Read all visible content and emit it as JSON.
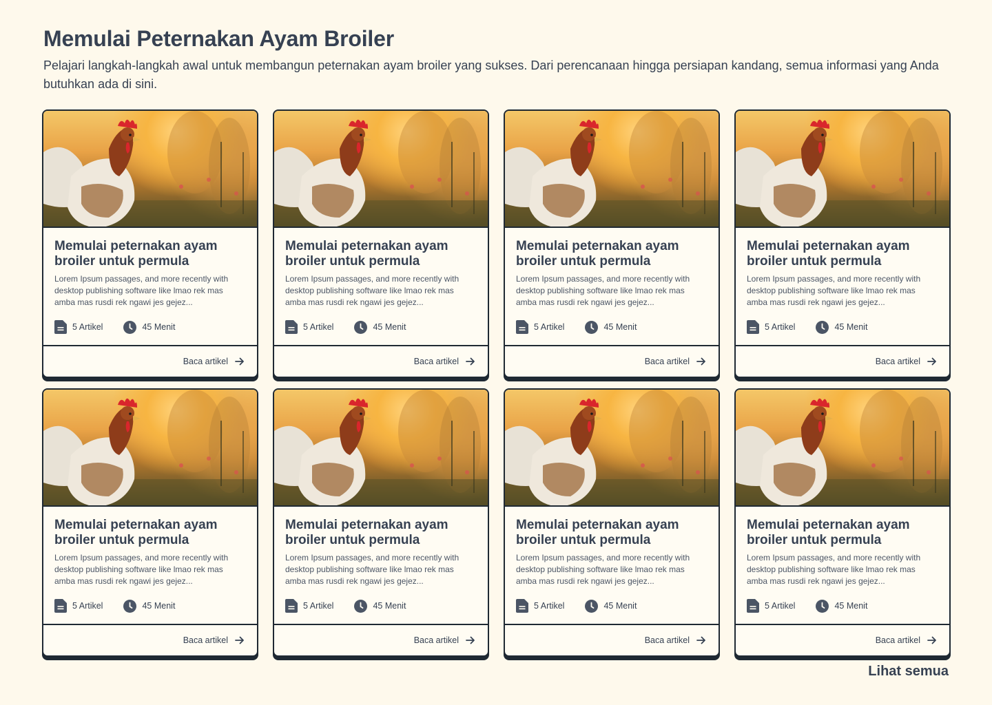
{
  "header": {
    "title": "Memulai Peternakan Ayam Broiler",
    "subtitle": "Pelajari langkah-langkah awal untuk membangun peternakan ayam broiler yang sukses. Dari perencanaan hingga persiapan kandang, semua informasi yang Anda butuhkan ada di sini."
  },
  "cards": [
    {
      "title": "Memulai peternakan ayam broiler untuk permula",
      "desc": "Lorem Ipsum passages, and more recently with desktop publishing software like lmao rek mas amba mas rusdi rek ngawi jes gejez...",
      "articles": "5 Artikel",
      "duration": "45 Menit",
      "cta": "Baca artikel"
    },
    {
      "title": "Memulai peternakan ayam broiler untuk permula",
      "desc": "Lorem Ipsum passages, and more recently with desktop publishing software like lmao rek mas amba mas rusdi rek ngawi jes gejez...",
      "articles": "5 Artikel",
      "duration": "45 Menit",
      "cta": "Baca artikel"
    },
    {
      "title": "Memulai peternakan ayam broiler untuk permula",
      "desc": "Lorem Ipsum passages, and more recently with desktop publishing software like lmao rek mas amba mas rusdi rek ngawi jes gejez...",
      "articles": "5 Artikel",
      "duration": "45 Menit",
      "cta": "Baca artikel"
    },
    {
      "title": "Memulai peternakan ayam broiler untuk permula",
      "desc": "Lorem Ipsum passages, and more recently with desktop publishing software like lmao rek mas amba mas rusdi rek ngawi jes gejez...",
      "articles": "5 Artikel",
      "duration": "45 Menit",
      "cta": "Baca artikel"
    },
    {
      "title": "Memulai peternakan ayam broiler untuk permula",
      "desc": "Lorem Ipsum passages, and more recently with desktop publishing software like lmao rek mas amba mas rusdi rek ngawi jes gejez...",
      "articles": "5 Artikel",
      "duration": "45 Menit",
      "cta": "Baca artikel"
    },
    {
      "title": "Memulai peternakan ayam broiler untuk permula",
      "desc": "Lorem Ipsum passages, and more recently with desktop publishing software like lmao rek mas amba mas rusdi rek ngawi jes gejez...",
      "articles": "5 Artikel",
      "duration": "45 Menit",
      "cta": "Baca artikel"
    },
    {
      "title": "Memulai peternakan ayam broiler untuk permula",
      "desc": "Lorem Ipsum passages, and more recently with desktop publishing software like lmao rek mas amba mas rusdi rek ngawi jes gejez...",
      "articles": "5 Artikel",
      "duration": "45 Menit",
      "cta": "Baca artikel"
    },
    {
      "title": "Memulai peternakan ayam broiler untuk permula",
      "desc": "Lorem Ipsum passages, and more recently with desktop publishing software like lmao rek mas amba mas rusdi rek ngawi jes gejez...",
      "articles": "5 Artikel",
      "duration": "45 Menit",
      "cta": "Baca artikel"
    }
  ],
  "see_all": "Lihat semua",
  "icons": {
    "article": "document-icon",
    "duration": "clock-icon",
    "cta": "arrow-right-icon"
  },
  "colors": {
    "background": "#fef9ec",
    "text": "#364152",
    "border": "#1f2933"
  }
}
